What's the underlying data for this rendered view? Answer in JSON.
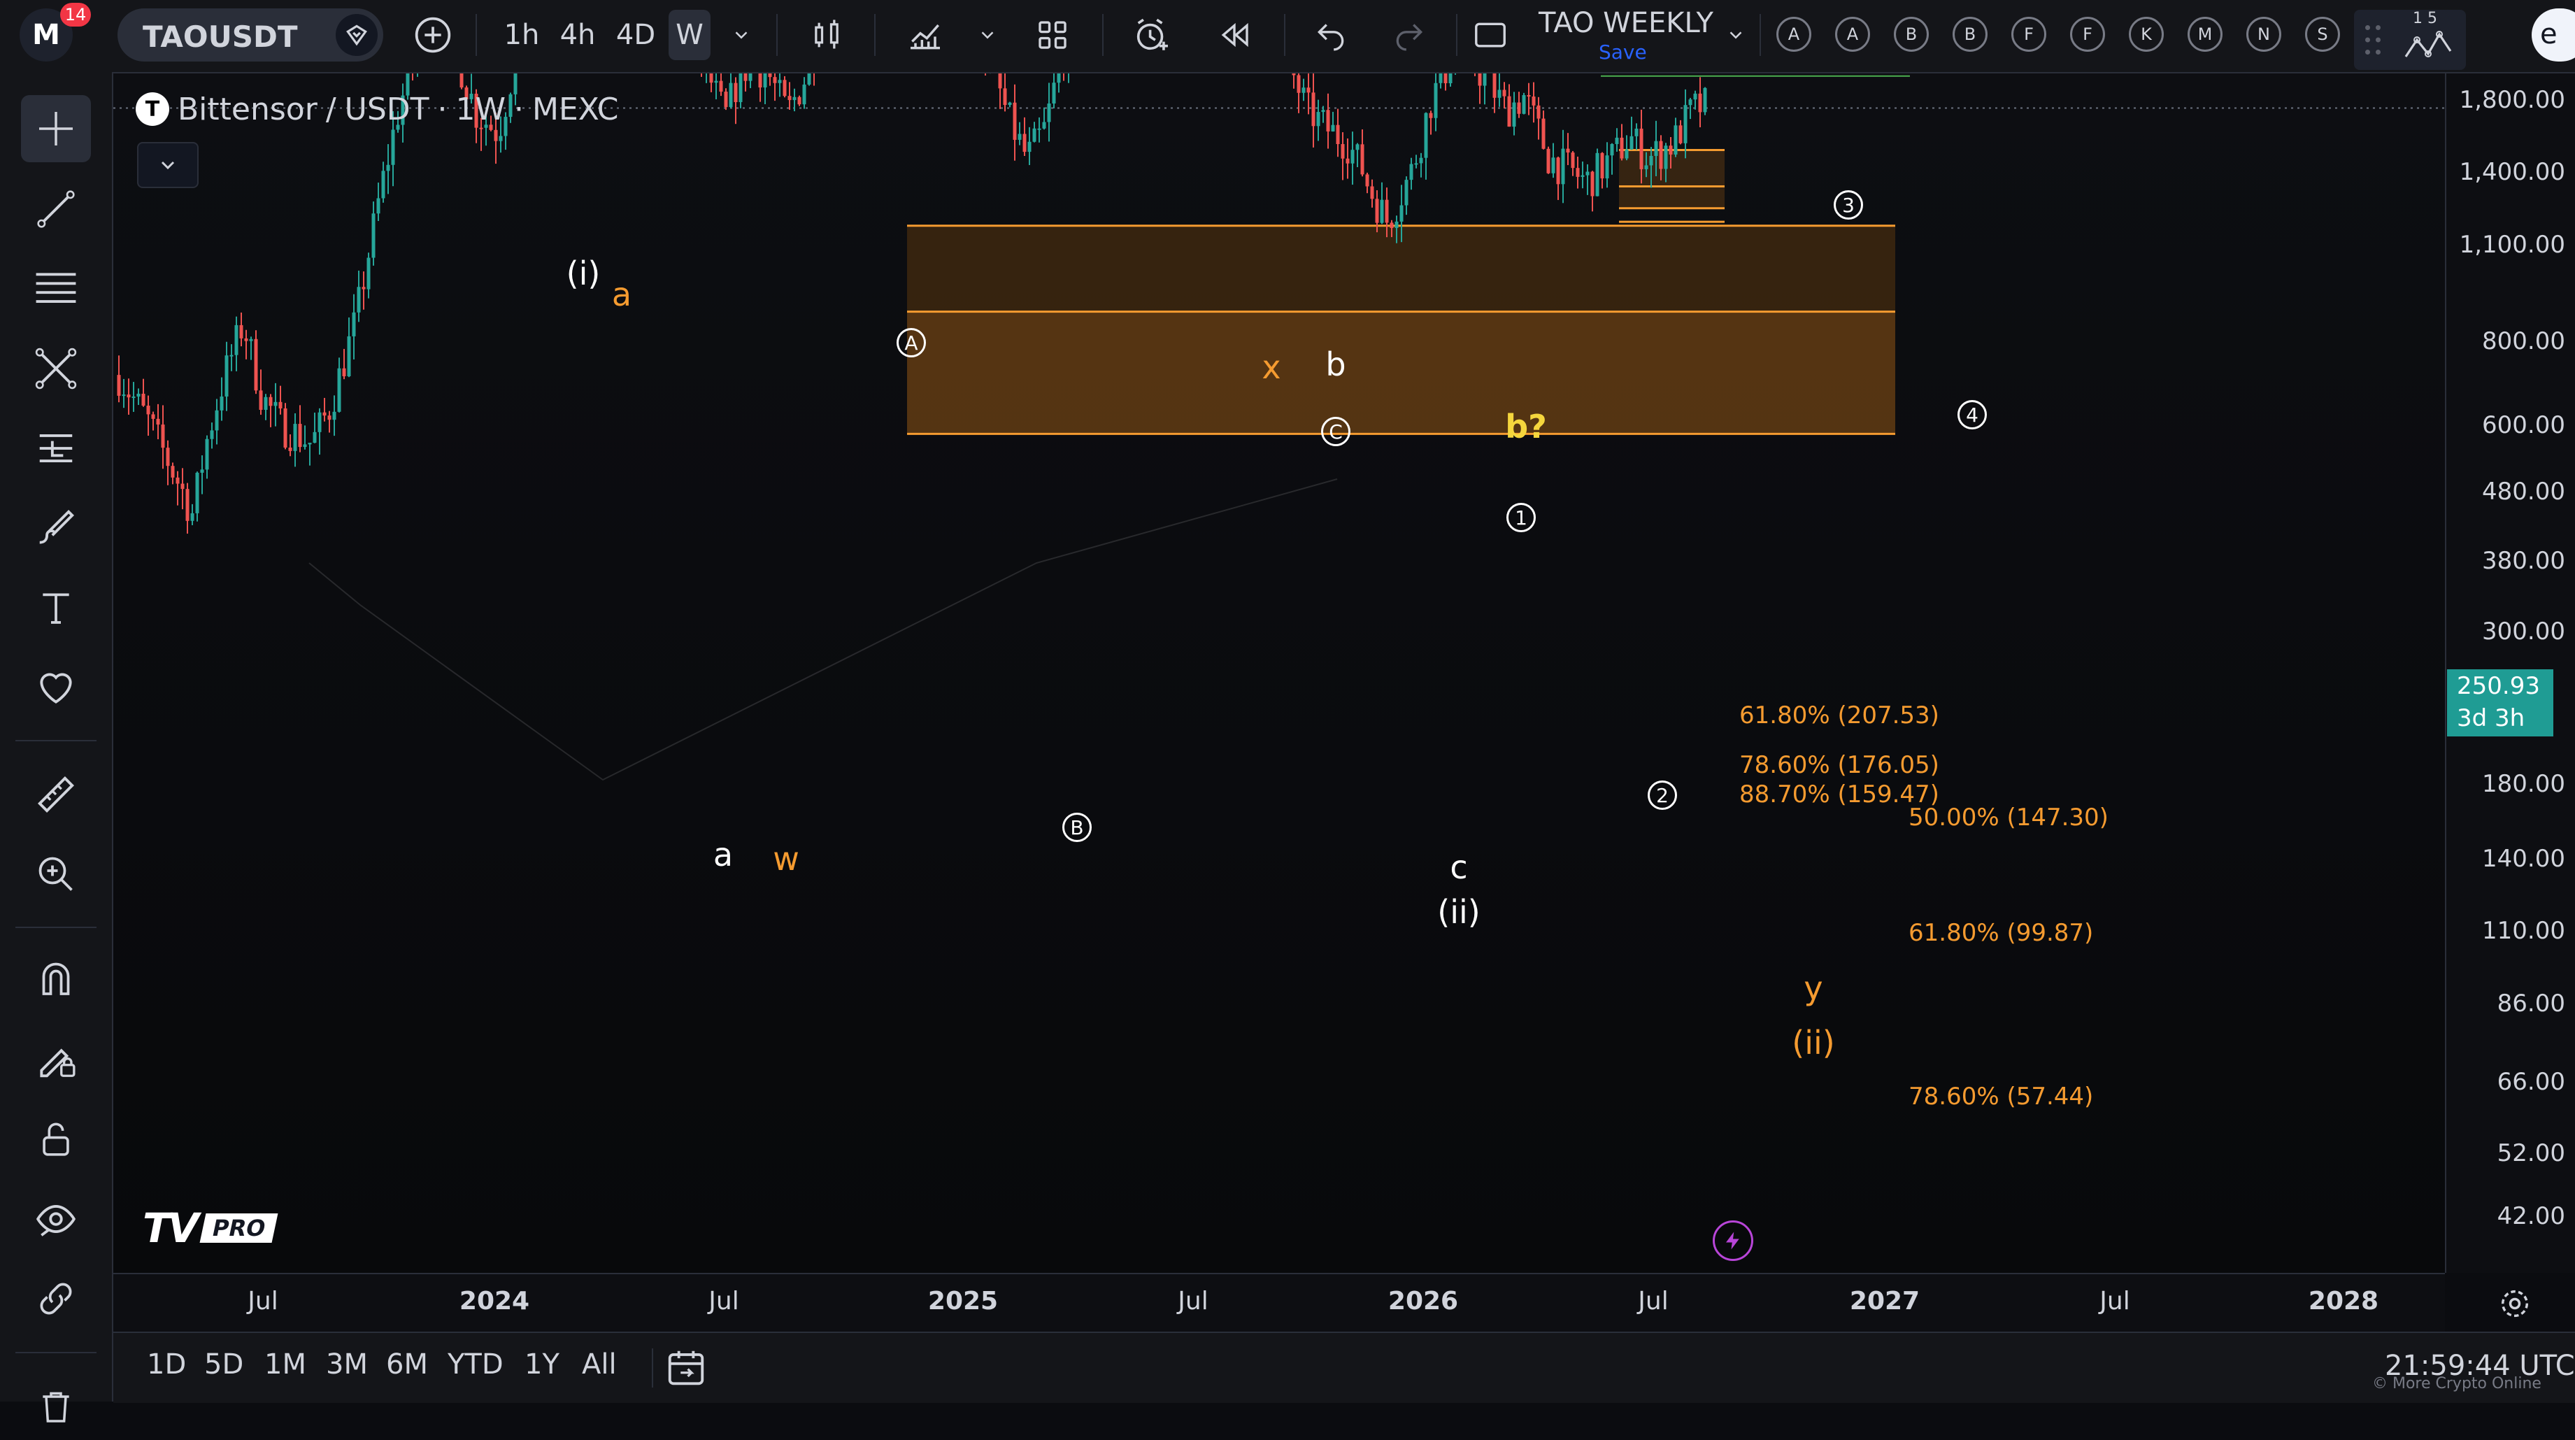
{
  "toolbar": {
    "notification_count": "14",
    "symbol": "TAOUSDT",
    "intervals": [
      "1h",
      "4h",
      "4D",
      "W"
    ],
    "selected_interval": "W",
    "layout_name": "TAO WEEKLY",
    "save_label": "Save",
    "alert_letters": [
      "A",
      "A",
      "B",
      "B",
      "F",
      "F",
      "K",
      "M",
      "N",
      "S"
    ],
    "right_small": "1 5",
    "right_edge_char": "e"
  },
  "legend": {
    "symbol_name": "Bittensor",
    "separator": "/",
    "quote": "USDT",
    "interval": "1W",
    "exchange": "MEXC",
    "dot": "·"
  },
  "price_axis": {
    "labels": [
      "1,800.00",
      "1,400.00",
      "1,100.00",
      "800.00",
      "600.00",
      "480.00",
      "380.00",
      "300.00",
      "180.00",
      "140.00",
      "110.00",
      "86.00",
      "66.00",
      "52.00",
      "42.00"
    ],
    "current_price": "250.93",
    "countdown": "3d 3h"
  },
  "time_axis": {
    "labels": [
      "Jul",
      "2024",
      "Jul",
      "2025",
      "Jul",
      "2026",
      "Jul",
      "2027",
      "Jul",
      "2028"
    ]
  },
  "annotations": {
    "wave_i": "(i)",
    "a_orange_top": "a",
    "A_circle": "A",
    "x_orange": "x",
    "b_white": "b",
    "C_circle": "C",
    "b_question": "b?",
    "one_circle": "1",
    "three_circle": "3",
    "four_circle": "4",
    "a_white_low": "a",
    "w_orange": "w",
    "B_circle": "B",
    "c_white": "c",
    "wave_ii": "(ii)",
    "two_circle": "2",
    "y_orange": "y",
    "wave_ii_orange": "(ii)"
  },
  "fib_levels": {
    "upper": [
      "61.80% (207.53)",
      "78.60% (176.05)",
      "88.70% (159.47)"
    ],
    "lower": [
      "50.00% (147.30)",
      "61.80% (99.87)",
      "78.60% (57.44)"
    ]
  },
  "watermark": {
    "logo": "TV",
    "pro": "PRO"
  },
  "bottom": {
    "ranges": [
      "1D",
      "5D",
      "1M",
      "3M",
      "6M",
      "YTD",
      "1Y",
      "All"
    ],
    "clock": "21:59:44 UTC",
    "credit": "© More Crypto Online"
  },
  "colors": {
    "up": "#26a69a",
    "down": "#ef5350",
    "fib_orange": "#f59b30",
    "price_badge": "#1f9c94",
    "bg": "#0b0c10"
  }
}
